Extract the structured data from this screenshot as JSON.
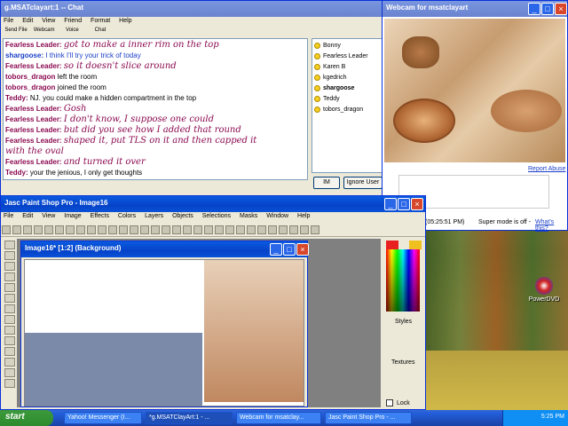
{
  "chat": {
    "title": "g.MSATclayart:1 -- Chat",
    "menu": [
      "File",
      "Edit",
      "View",
      "Friend",
      "Format",
      "Help"
    ],
    "toolbar": [
      "Send File",
      "Webcam",
      "Voice",
      "Chat"
    ],
    "messages": [
      {
        "who": "Fearless Leader:",
        "text": "got to make a inner rim on the top",
        "style": "script",
        "color": "#8b0a50"
      },
      {
        "who": "shargoose:",
        "text": "I think I'll try your trick of today",
        "style": "plain",
        "color": "#1a3ec8"
      },
      {
        "who": "Fearless Leader:",
        "text": "so it doesn't slice around",
        "style": "script",
        "color": "#8b0a50"
      },
      {
        "who": "tobors_dragon",
        "text": "left the room",
        "style": "sys",
        "color": "#8b0a50"
      },
      {
        "who": "tobors_dragon",
        "text": "joined the room",
        "style": "sys",
        "color": "#8b0a50"
      },
      {
        "who": "Teddy:",
        "text": "NJ. you could make a hidden compartment in the top",
        "style": "plain",
        "color": "#8b0a50"
      },
      {
        "who": "Fearless Leader:",
        "text": "Gosh",
        "style": "script",
        "color": "#8b0a50"
      },
      {
        "who": "Fearless Leader:",
        "text": "I don't know, I suppose one could",
        "style": "script",
        "color": "#8b0a50"
      },
      {
        "who": "Fearless Leader:",
        "text": "but did you see how I added that round",
        "style": "script",
        "color": "#8b0a50"
      },
      {
        "who": "Fearless Leader:",
        "text": "shaped it, put TLS on it and then capped it",
        "style": "script",
        "color": "#8b0a50"
      },
      {
        "who": "",
        "text": "with the oval",
        "style": "script",
        "color": "#8b0a50"
      },
      {
        "who": "Fearless Leader:",
        "text": "and turned it over",
        "style": "script",
        "color": "#8b0a50"
      },
      {
        "who": "Teddy:",
        "text": "your the jenious, I only get thoughts",
        "style": "plain",
        "color": "#8b0a50"
      }
    ],
    "users": [
      "Bonny",
      "Fearless Leader",
      "Karen B",
      "kgedrich",
      "shargoose",
      "Teddy",
      "tobors_dragon"
    ],
    "im_button": "IM",
    "ignore_button": "Ignore User"
  },
  "webcam": {
    "title": "Webcam for msatclayart",
    "report_abuse": "Report Abuse",
    "time": "(05:25:51 PM)",
    "status": "Super mode is off -",
    "whats_this": "What's this?"
  },
  "psp": {
    "title": "Jasc Paint Shop Pro - Image16",
    "menu": [
      "File",
      "Edit",
      "View",
      "Image",
      "Effects",
      "Colors",
      "Layers",
      "Objects",
      "Selections",
      "Masks",
      "Window",
      "Help"
    ],
    "image_title": "Image16* [1:2] (Background)",
    "styles_label": "Styles",
    "textures_label": "Textures",
    "lock_label": "Lock"
  },
  "desktop": {
    "icon_label": "PowerDVD"
  },
  "taskbar": {
    "start": "start",
    "tasks": [
      "Yahoo! Messenger (I...",
      "*g.MSATClayArt:1 - ...",
      "Webcam for msatclay...",
      "Jasc Paint Shop Pro - ..."
    ],
    "clock": "5:25 PM"
  },
  "colors": {
    "script": "#8b0a50",
    "link": "#1a3ec8",
    "titlebar": "#0542c8"
  }
}
